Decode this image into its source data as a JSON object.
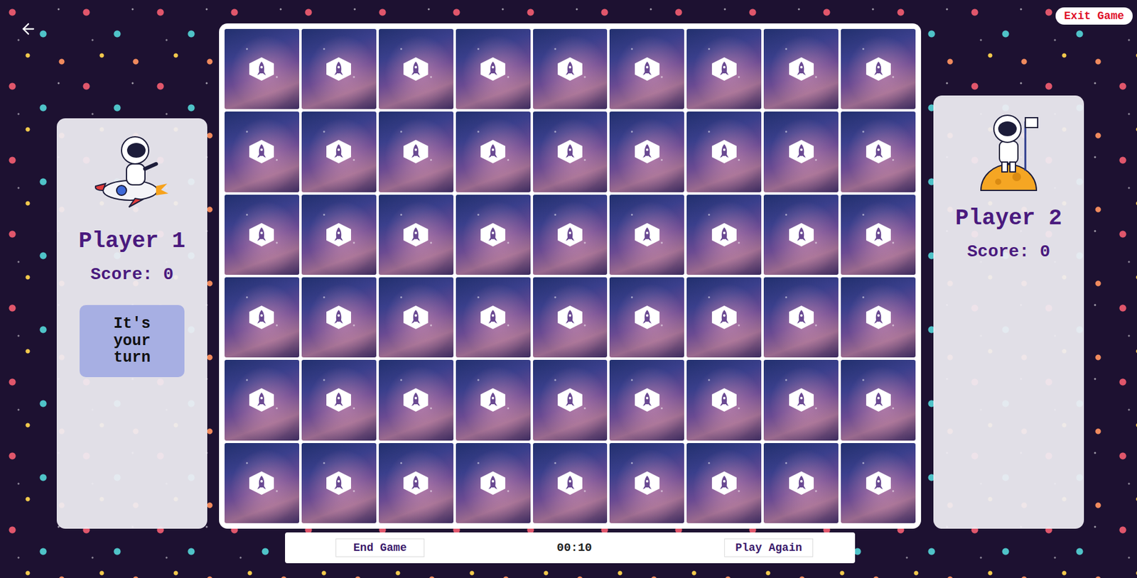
{
  "exit_button": "Exit Game",
  "players": [
    {
      "name": "Player 1",
      "score_label": "Score: 0",
      "turn_message": "It's your turn",
      "active": true
    },
    {
      "name": "Player 2",
      "score_label": "Score: 0",
      "active": false
    }
  ],
  "board": {
    "rows": [
      [
        {
          "flipped": false
        },
        {
          "flipped": false
        },
        {
          "flipped": false
        },
        {
          "flipped": false
        },
        {
          "flipped": false
        },
        {
          "flipped": false
        },
        {
          "flipped": false
        },
        {
          "flipped": false
        },
        {
          "flipped": false
        }
      ],
      [
        {
          "flipped": false
        },
        {
          "flipped": false
        },
        {
          "flipped": false
        },
        {
          "flipped": false
        },
        {
          "flipped": false
        },
        {
          "flipped": false
        },
        {
          "flipped": false
        },
        {
          "flipped": false
        },
        {
          "flipped": false
        }
      ],
      [
        {
          "flipped": false
        },
        {
          "flipped": false
        },
        {
          "flipped": false
        },
        {
          "flipped": false
        },
        {
          "flipped": false
        },
        {
          "flipped": false
        },
        {
          "flipped": false
        },
        {
          "flipped": false
        },
        {
          "flipped": false
        }
      ],
      [
        {
          "flipped": false
        },
        {
          "flipped": false
        },
        {
          "flipped": false
        },
        {
          "flipped": false
        },
        {
          "flipped": false
        },
        {
          "flipped": false
        },
        {
          "flipped": false
        },
        {
          "flipped": false
        },
        {
          "flipped": false
        }
      ],
      [
        {
          "flipped": false
        },
        {
          "flipped": false
        },
        {
          "flipped": false
        },
        {
          "flipped": false
        },
        {
          "flipped": false
        },
        {
          "flipped": false
        },
        {
          "flipped": false
        },
        {
          "flipped": false
        },
        {
          "flipped": false
        }
      ],
      [
        {
          "flipped": false
        },
        {
          "flipped": false
        },
        {
          "flipped": false
        },
        {
          "flipped": false
        },
        {
          "flipped": false
        },
        {
          "flipped": false
        },
        {
          "flipped": false
        },
        {
          "flipped": false
        },
        {
          "flipped": false
        }
      ]
    ]
  },
  "footer": {
    "end_button": "End Game",
    "timer": "00:10",
    "play_again_button": "Play Again"
  }
}
